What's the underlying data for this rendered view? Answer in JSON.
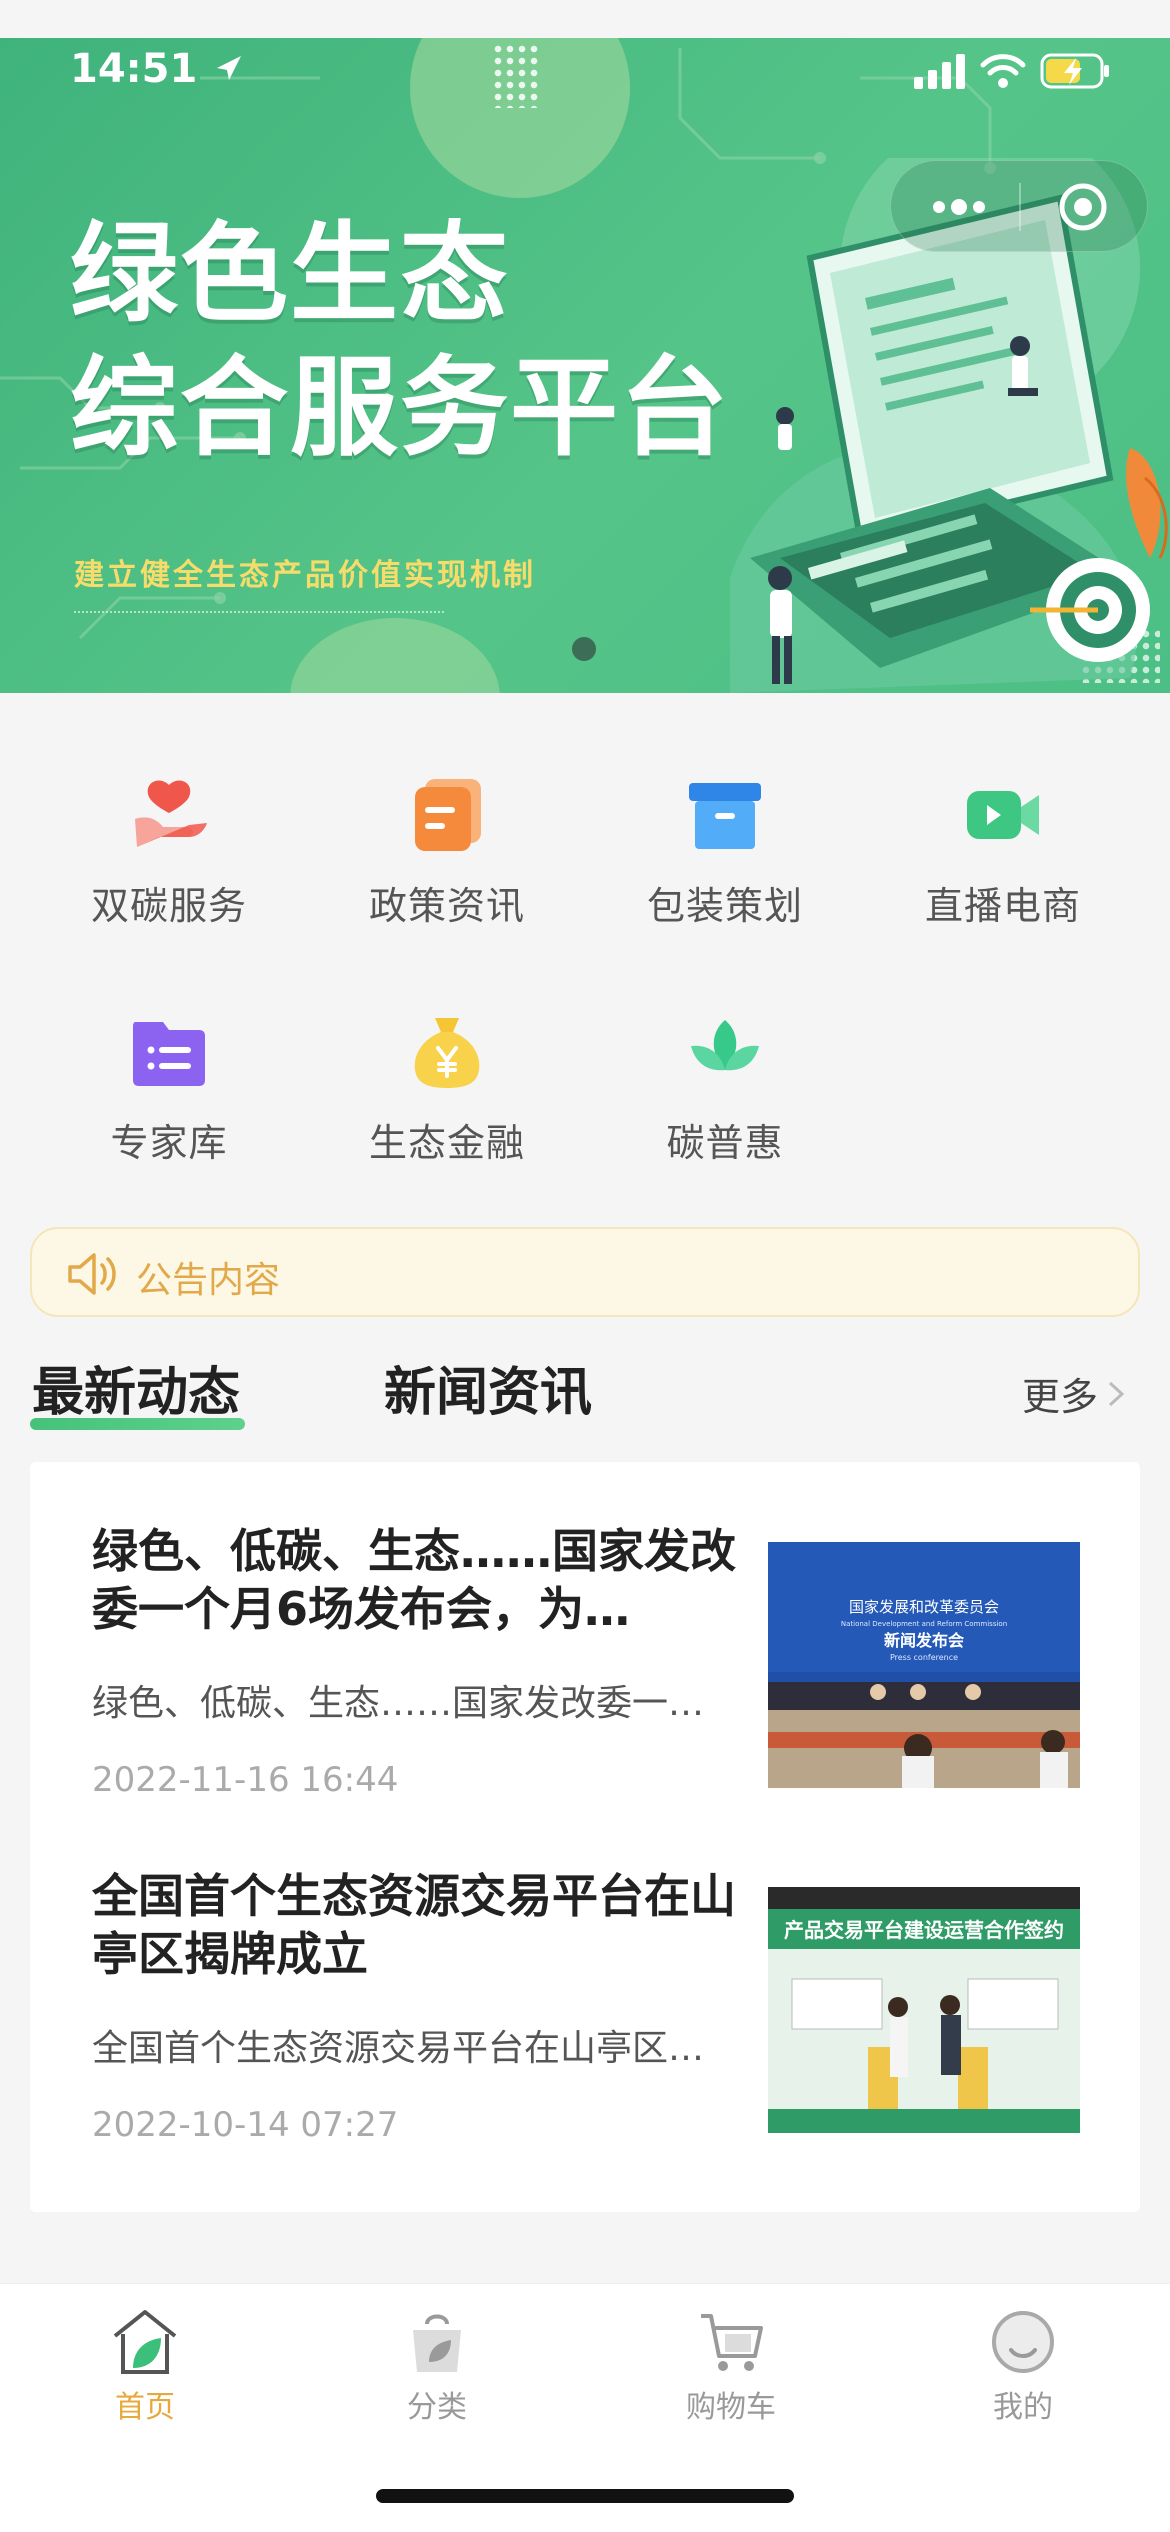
{
  "status_bar": {
    "time": "14:51"
  },
  "banner": {
    "title_line1": "绿色生态",
    "title_line2": "综合服务平台",
    "subtitle": "建立健全生态产品价值实现机制"
  },
  "capsule": {
    "more_icon": "more-dots-icon",
    "close_icon": "target-close-icon"
  },
  "grid": [
    {
      "label": "双碳服务",
      "icon": "heart-hand-icon",
      "color": "#f0574b"
    },
    {
      "label": "政策资讯",
      "icon": "document-icon",
      "color": "#f58a3c"
    },
    {
      "label": "包装策划",
      "icon": "box-icon",
      "color": "#3c9cf3"
    },
    {
      "label": "直播电商",
      "icon": "video-icon",
      "color": "#3ec783"
    },
    {
      "label": "专家库",
      "icon": "folder-list-icon",
      "color": "#8b63f0"
    },
    {
      "label": "生态金融",
      "icon": "money-bag-icon",
      "color": "#f5c533"
    },
    {
      "label": "碳普惠",
      "icon": "leaf-icon",
      "color": "#36c98a"
    }
  ],
  "notice": {
    "text": "公告内容",
    "icon": "speaker-icon"
  },
  "tabs": {
    "active": "最新动态",
    "second": "新闻资讯",
    "more": "更多"
  },
  "news": [
    {
      "title": "绿色、低碳、生态……国家发改委一个月6场发布会，为…",
      "summary": "绿色、低碳、生态……国家发改委一…",
      "date": "2022-11-16 16:44",
      "thumb_caption_line1": "国家发展和改革委员会",
      "thumb_caption_line2": "National Development and Reform Commission",
      "thumb_caption_line3": "新闻发布会",
      "thumb_caption_line4": "Press conference"
    },
    {
      "title": "全国首个生态资源交易平台在山亭区揭牌成立",
      "summary": "全国首个生态资源交易平台在山亭区…",
      "date": "2022-10-14 07:27",
      "thumb_caption_line1": "产品交易平台建设运营合作签约"
    }
  ],
  "tabbar": [
    {
      "label": "首页",
      "icon": "home-leaf-icon",
      "active": true
    },
    {
      "label": "分类",
      "icon": "bag-leaf-icon",
      "active": false
    },
    {
      "label": "购物车",
      "icon": "cart-icon",
      "active": false
    },
    {
      "label": "我的",
      "icon": "user-smile-icon",
      "active": false
    }
  ],
  "colors": {
    "accent_green": "#46c27a",
    "accent_gold": "#e7a93c",
    "notice_text": "#e1a94a"
  }
}
